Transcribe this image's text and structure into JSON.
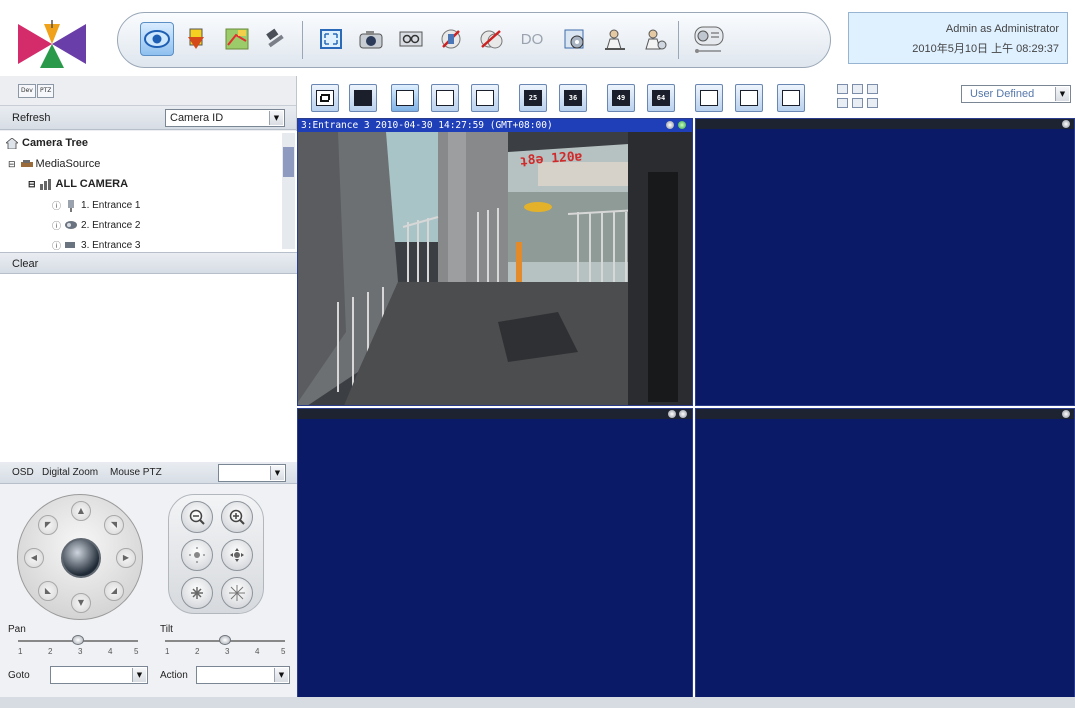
{
  "toolbar": {
    "buttons": [
      {
        "name": "live-view-icon",
        "active": true
      },
      {
        "name": "event-icon"
      },
      {
        "name": "map-icon"
      },
      {
        "name": "tools-icon"
      },
      {
        "name": "fullscreen-icon"
      },
      {
        "name": "snapshot-icon"
      },
      {
        "name": "record-icon"
      },
      {
        "name": "audio-icon"
      },
      {
        "name": "mute-icon"
      },
      {
        "name": "digital-output-icon",
        "label": "DO"
      },
      {
        "name": "settings-icon"
      },
      {
        "name": "user-icon"
      },
      {
        "name": "user-manage-icon"
      },
      {
        "name": "logout-icon"
      }
    ]
  },
  "userbox": {
    "line1": "Admin as Administrator",
    "line2": "2010年5月10日 上午 08:29:37"
  },
  "left": {
    "tabs": [
      "Dev",
      "PTZ"
    ],
    "refresh_label": "Refresh",
    "camera_id_select": "Camera ID",
    "tree": {
      "root": "Camera Tree",
      "source": "MediaSource",
      "group": "ALL CAMERA",
      "items": [
        "1. Entrance 1",
        "2. Entrance 2",
        "3. Entrance 3"
      ]
    },
    "clear_label": "Clear",
    "ptz_tabs": [
      "OSD",
      "Digital Zoom",
      "Mouse PTZ"
    ],
    "pan_label": "Pan",
    "tilt_label": "Tilt",
    "pan_ticks": [
      "1",
      "2",
      "3",
      "4",
      "5"
    ],
    "tilt_ticks": [
      "1",
      "2",
      "3",
      "4",
      "5"
    ],
    "pan_value": 3,
    "tilt_value": 3,
    "goto_label": "Goto",
    "action_label": "Action"
  },
  "main": {
    "layout_buttons": [
      {
        "name": "sequence-layout-button",
        "label": ""
      },
      {
        "name": "layout-1-button",
        "label": ""
      },
      {
        "name": "layout-4-button",
        "label": "",
        "active": true
      },
      {
        "name": "layout-9-button",
        "label": ""
      },
      {
        "name": "layout-16-button",
        "label": ""
      },
      {
        "name": "layout-25-button",
        "label": "25"
      },
      {
        "name": "layout-36-button",
        "label": "36"
      },
      {
        "name": "layout-49-button",
        "label": "49"
      },
      {
        "name": "layout-64-button",
        "label": "64"
      },
      {
        "name": "layout-custom-1-button",
        "label": ""
      },
      {
        "name": "layout-custom-2-button",
        "label": ""
      },
      {
        "name": "layout-custom-3-button",
        "label": ""
      }
    ],
    "layout_select": "User Defined",
    "cells": [
      {
        "title": "3:Entrance 3   2010-04-30 14:27:59 (GMT+08:00)",
        "active": true
      },
      {
        "title": ""
      },
      {
        "title": ""
      },
      {
        "title": ""
      }
    ]
  },
  "colors": {
    "video_bg": "#0a1a66",
    "active_title_bar": "#1e3fb8",
    "userbox_bg": "#dff0ff"
  }
}
